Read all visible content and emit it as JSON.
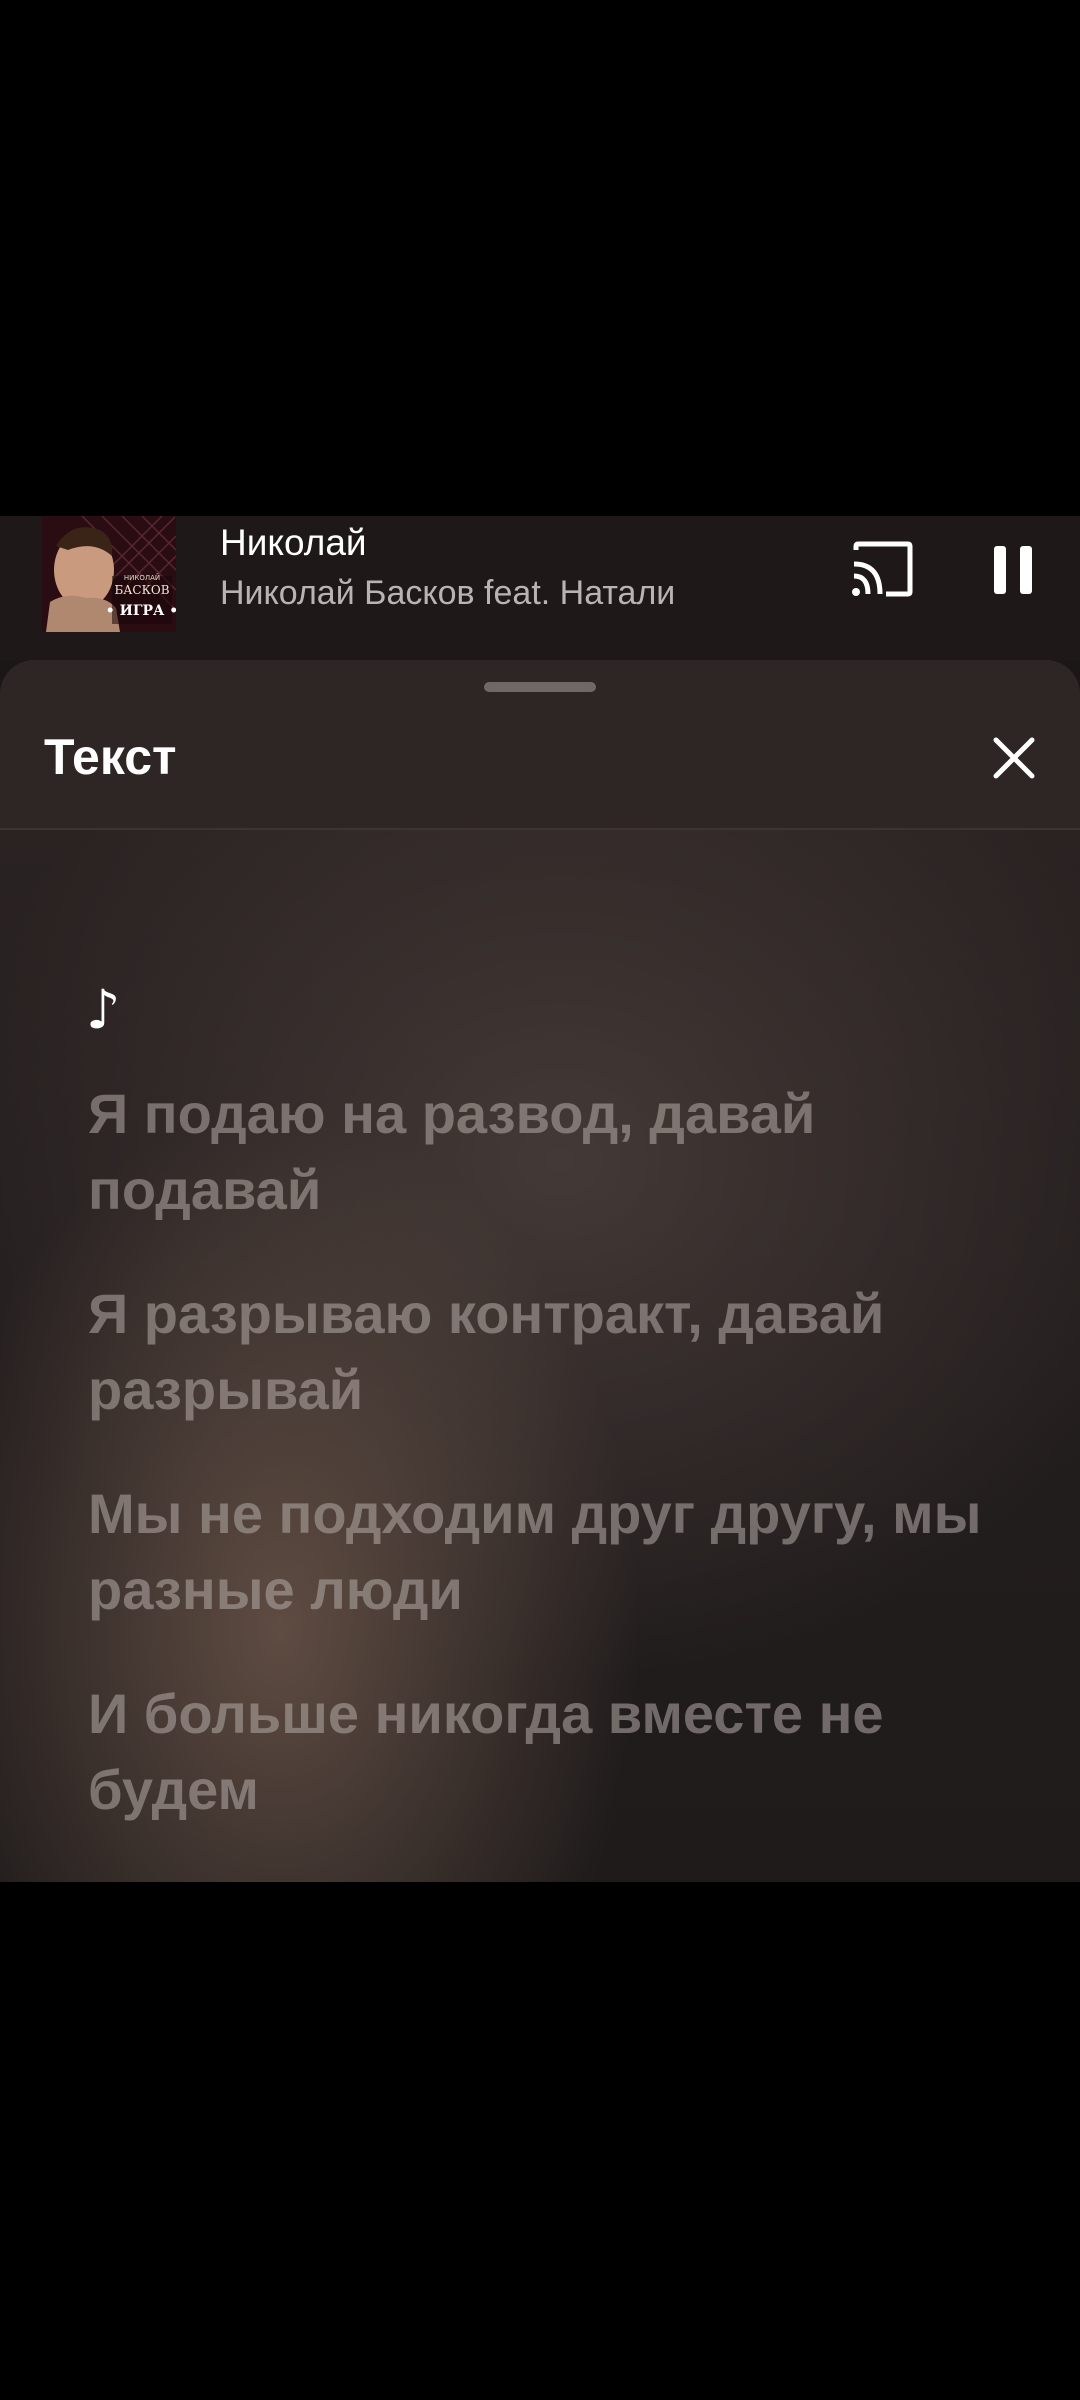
{
  "player": {
    "title": "Николай",
    "artist": "Николай Басков feat. Натали",
    "album_art_text": {
      "line1": "НИКОЛАЙ",
      "line2": "БАСКОВ",
      "line3": "• ИГРА •"
    },
    "cast_icon": "cast-icon",
    "pause_icon": "pause-icon"
  },
  "sheet": {
    "title": "Текст",
    "close_icon": "close-icon"
  },
  "lyrics": {
    "note": "♪",
    "lines": [
      "Я подаю на развод, давай подавай",
      "Я разрываю контракт, давай разрывай",
      "Мы не подходим друг другу, мы разные люди",
      "И больше никогда вместе не будем"
    ]
  },
  "colors": {
    "background": "#000000",
    "header": "#2d2624",
    "lyric_inactive": "#8a817d",
    "accent_white": "#ffffff"
  }
}
